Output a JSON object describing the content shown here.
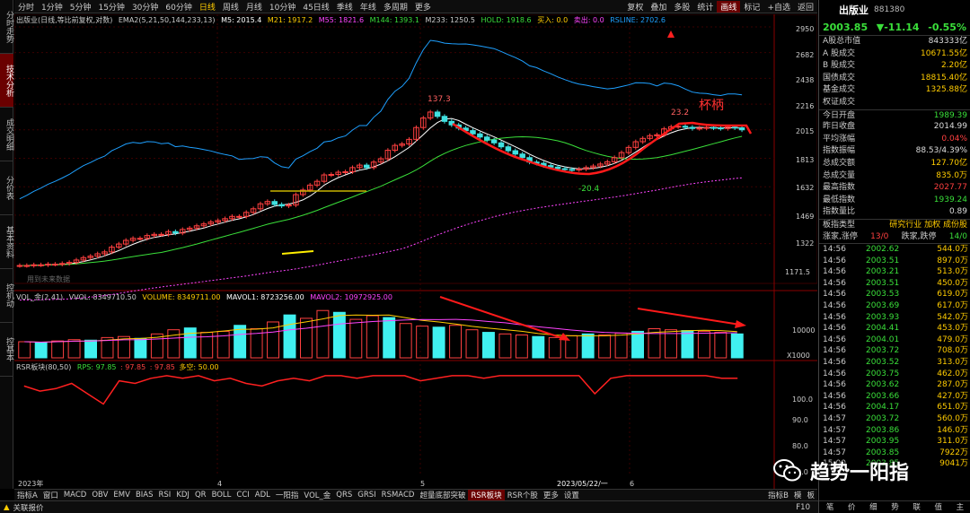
{
  "left_tabs": [
    {
      "label": "分时走势",
      "active": false
    },
    {
      "label": "技术分析",
      "active": true
    },
    {
      "label": "成交明细",
      "active": false
    },
    {
      "label": "分价表",
      "active": false
    },
    {
      "label": "基本资料",
      "active": false
    },
    {
      "label": "控机动",
      "active": false
    },
    {
      "label": "控基本",
      "active": false
    }
  ],
  "periods": [
    "分时",
    "1分钟",
    "5分钟",
    "15分钟",
    "30分钟",
    "60分钟",
    "日线",
    "周线",
    "月线",
    "10分钟",
    "45日线",
    "季线",
    "年线",
    "多周期",
    "更多"
  ],
  "active_period": "日线",
  "tools": [
    "复权",
    "叠加",
    "多股",
    "统计",
    "画线",
    "标记",
    "+自选",
    "返回"
  ],
  "active_tool": "画线",
  "indicator_line": {
    "name": "出版业(日线,等比前复权,对数)",
    "ema": "EMA2(5,21,50,144,233,13)",
    "m5": "M5: 2015.4",
    "m21": "M21: 1917.2",
    "m55": "M55: 1821.6",
    "m144": "M144: 1393.1",
    "m233": "M233: 1250.5",
    "hold": "HOLD: 1918.6",
    "buy": "买入: 0.0",
    "sell": "卖出: 0.0",
    "rsline": "RSLINE: 2702.6"
  },
  "vol_line": {
    "name": "VOL_金(2,41)",
    "vvol": "VVOL: 8349710.50",
    "volume": "VOLUME: 8349711.00",
    "mavol1": "MAVOL1: 8723256.00",
    "mavol2": "MAVOL2: 10972925.00"
  },
  "rsr_line": {
    "name": "RSR板块(80,50)",
    "rps": "RPS: 97.85",
    "v1": ": 97.85",
    "v2": ": 97.85",
    "kw": "多空: 50.00"
  },
  "price_axis": [
    "2950",
    "2682",
    "2438",
    "2216",
    "2015",
    "1813",
    "1632",
    "1469",
    "1322"
  ],
  "price_axis_bottom": "1171.5",
  "vol_axis": [
    "10000",
    "X1000"
  ],
  "rsr_axis": [
    "100.0",
    "90.0",
    "80.0",
    "70.0"
  ],
  "x_labels": [
    "2023年",
    "4",
    "5",
    "2023/05/22/一",
    "6"
  ],
  "annotations": {
    "high1": "137.3",
    "high2": "23.2",
    "low": "-20.4",
    "cup": "杯柄",
    "use_hint": "用到未来数据"
  },
  "chart_data": {
    "type": "candlestick",
    "scale": "log",
    "ylim": [
      1171.5,
      2950
    ],
    "close": [
      1219,
      1219,
      1222,
      1222,
      1225,
      1225,
      1228,
      1233,
      1244,
      1255,
      1262,
      1273,
      1282,
      1305,
      1320,
      1338,
      1348,
      1348,
      1362,
      1368,
      1368,
      1382,
      1375,
      1393,
      1400,
      1412,
      1422,
      1432,
      1440,
      1450,
      1462,
      1462,
      1484,
      1504,
      1532,
      1545,
      1528,
      1520,
      1525,
      1585,
      1612,
      1642,
      1665,
      1705,
      1708,
      1722,
      1725,
      1752,
      1768,
      1752,
      1788,
      1810,
      1868,
      1902,
      1912,
      1945,
      2032,
      2105,
      2152,
      2118,
      2079,
      2052,
      2028,
      2009,
      1985,
      1962,
      1940,
      1920,
      1892,
      1865,
      1842,
      1818,
      1788,
      1780,
      1765,
      1755,
      1745,
      1740,
      1738,
      1742,
      1752,
      1762,
      1775,
      1790,
      1818,
      1852,
      1888,
      1928,
      1952,
      1972,
      1978,
      2022,
      2038,
      2042,
      2034,
      2025,
      2028,
      2033,
      2029,
      2025,
      2035,
      2030,
      2015
    ],
    "volume_bars_x1000": [
      6200,
      5900,
      6500,
      7000,
      6800,
      7800,
      8200,
      7500,
      9200,
      10800,
      11500,
      9800,
      10200,
      12500,
      11200,
      13800,
      16500,
      15200,
      18200,
      17500,
      14800,
      16200,
      15500,
      13200,
      12200,
      11800,
      12500,
      10800,
      9800,
      9200,
      8800,
      8200,
      7800,
      8500,
      9200,
      8800,
      9500,
      10200,
      11200,
      10800,
      10500,
      10200,
      9800,
      9200
    ],
    "rsr": [
      95,
      93,
      94,
      96,
      92,
      88,
      97,
      96,
      98,
      99,
      98,
      99,
      97,
      98,
      96,
      95,
      97,
      98,
      97,
      99,
      99,
      98,
      99,
      99,
      99,
      97,
      98,
      99,
      99,
      98,
      99,
      99,
      99,
      99,
      99,
      99,
      92,
      98,
      99,
      99,
      99,
      99,
      99,
      99,
      98,
      98
    ],
    "series": [
      {
        "name": "M5"
      },
      {
        "name": "M21"
      },
      {
        "name": "M55"
      },
      {
        "name": "M144"
      },
      {
        "name": "M233"
      }
    ],
    "colors": {
      "up": "#ff4040",
      "down": "#40e0e0",
      "ma5": "#ffffff",
      "ma21": "#ffcc00",
      "ma55": "#ff44ff",
      "ma144": "#3adf3a",
      "rsline": "#1ea0ff",
      "rsr": "#ff2020"
    }
  },
  "right": {
    "name": "出版业",
    "code": "881380",
    "price": "2003.85",
    "change": "▼-11.14",
    "pct": "-0.55%",
    "stats": [
      {
        "label": "A股总市值",
        "value": "843333亿"
      },
      {
        "label": "A 股成交",
        "value": "10671.55亿"
      },
      {
        "label": "B 股成交",
        "value": "2.20亿"
      },
      {
        "label": "国债成交",
        "value": "18815.40亿"
      },
      {
        "label": "基金成交",
        "value": "1325.88亿"
      },
      {
        "label": "权证成交",
        "value": ""
      },
      {
        "label": "今日开盘",
        "value": "1989.39"
      },
      {
        "label": "昨日收盘",
        "value": "2014.99"
      },
      {
        "label": "平均涨幅",
        "value": "0.04%"
      },
      {
        "label": "指数振幅",
        "value": "88.53/4.39%"
      },
      {
        "label": "总成交额",
        "value": "127.70亿"
      },
      {
        "label": "总成交量",
        "value": "835.0万"
      },
      {
        "label": "最高指数",
        "value": "2027.77"
      },
      {
        "label": "最低指数",
        "value": "1939.24"
      },
      {
        "label": "指数量比",
        "value": "0.89"
      }
    ],
    "board_type_label": "板指类型",
    "board_type_value": "研究行业 加权 成份股",
    "rise_label": "涨家,涨停",
    "rise_value": "13/0",
    "fall_label": "跌家,跌停",
    "fall_value": "14/0",
    "ticks": [
      {
        "t": "14:56",
        "p": "2002.62",
        "v": "544.0万"
      },
      {
        "t": "14:56",
        "p": "2003.51",
        "v": "897.0万"
      },
      {
        "t": "14:56",
        "p": "2003.21",
        "v": "513.0万"
      },
      {
        "t": "14:56",
        "p": "2003.51",
        "v": "450.0万"
      },
      {
        "t": "14:56",
        "p": "2003.53",
        "v": "619.0万"
      },
      {
        "t": "14:56",
        "p": "2003.69",
        "v": "617.0万"
      },
      {
        "t": "14:56",
        "p": "2003.93",
        "v": "542.0万"
      },
      {
        "t": "14:56",
        "p": "2004.41",
        "v": "453.0万"
      },
      {
        "t": "14:56",
        "p": "2004.01",
        "v": "479.0万"
      },
      {
        "t": "14:56",
        "p": "2003.72",
        "v": "708.0万"
      },
      {
        "t": "14:56",
        "p": "2003.52",
        "v": "313.0万"
      },
      {
        "t": "14:56",
        "p": "2003.75",
        "v": "462.0万"
      },
      {
        "t": "14:56",
        "p": "2003.62",
        "v": "287.0万"
      },
      {
        "t": "14:56",
        "p": "2003.66",
        "v": "427.0万"
      },
      {
        "t": "14:56",
        "p": "2004.17",
        "v": "651.0万"
      },
      {
        "t": "14:57",
        "p": "2003.72",
        "v": "560.0万"
      },
      {
        "t": "14:57",
        "p": "2003.86",
        "v": "146.0万"
      },
      {
        "t": "14:57",
        "p": "2003.95",
        "v": "311.0万"
      },
      {
        "t": "14:57",
        "p": "2003.85",
        "v": "7922万"
      },
      {
        "t": "15:00",
        "p": "2003.85",
        "v": "9041万"
      }
    ],
    "bottom_tabs": [
      "笔",
      "价",
      "细",
      "势",
      "联",
      "值",
      "主"
    ]
  },
  "bottom_tabs": [
    "指标A",
    "窗口",
    "MACD",
    "OBV",
    "EMV",
    "BIAS",
    "RSI",
    "KDJ",
    "QR",
    "BOLL",
    "CCI",
    "ADL",
    "一阳指",
    "VOL_金",
    "QRS",
    "GRSI",
    "RSMACD",
    "超量底部突破",
    "RSR板块",
    "RSR个股",
    "更多",
    "设置"
  ],
  "active_bottom_tab": "RSR板块",
  "bottom_right_tabs": [
    "指标B",
    "模",
    "板"
  ],
  "status": {
    "left": "关联报价",
    "right": "F10"
  },
  "watermark": "趋势一阳指"
}
